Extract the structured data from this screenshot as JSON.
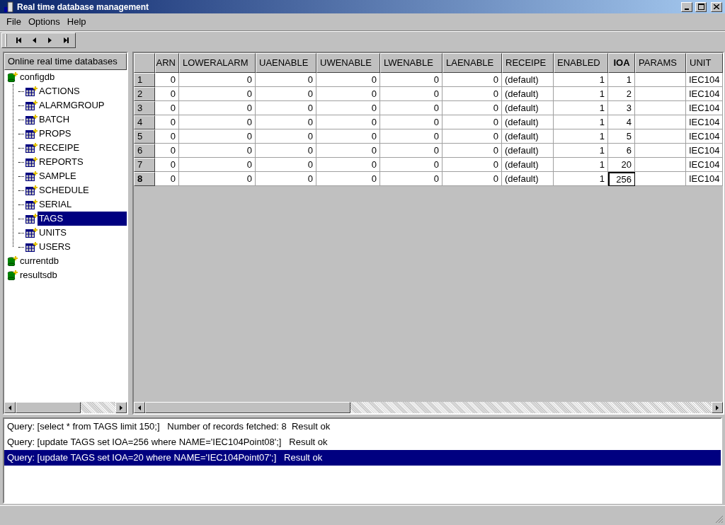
{
  "window": {
    "title": "Real time database management"
  },
  "menu": [
    "File",
    "Options",
    "Help"
  ],
  "tree": {
    "header": "Online real time databases",
    "items": [
      {
        "label": "configdb",
        "kind": "database",
        "selected": false,
        "children": [
          {
            "label": "ACTIONS",
            "kind": "table",
            "selected": false
          },
          {
            "label": "ALARMGROUP",
            "kind": "table",
            "selected": false
          },
          {
            "label": "BATCH",
            "kind": "table",
            "selected": false
          },
          {
            "label": "PROPS",
            "kind": "table",
            "selected": false
          },
          {
            "label": "RECEIPE",
            "kind": "table",
            "selected": false
          },
          {
            "label": "REPORTS",
            "kind": "table",
            "selected": false
          },
          {
            "label": "SAMPLE",
            "kind": "table",
            "selected": false
          },
          {
            "label": "SCHEDULE",
            "kind": "table",
            "selected": false
          },
          {
            "label": "SERIAL",
            "kind": "table",
            "selected": false
          },
          {
            "label": "TAGS",
            "kind": "table",
            "selected": true
          },
          {
            "label": "UNITS",
            "kind": "table",
            "selected": false
          },
          {
            "label": "USERS",
            "kind": "table",
            "selected": false
          }
        ]
      },
      {
        "label": "currentdb",
        "kind": "database",
        "selected": false
      },
      {
        "label": "resultsdb",
        "kind": "database",
        "selected": false
      }
    ]
  },
  "table": {
    "columns": [
      {
        "heading": "ARN",
        "kind": "number",
        "selected": false
      },
      {
        "heading": "LOWERALARM",
        "kind": "number",
        "selected": false
      },
      {
        "heading": "UAENABLE",
        "kind": "number",
        "selected": false
      },
      {
        "heading": "UWENABLE",
        "kind": "number",
        "selected": false
      },
      {
        "heading": "LWENABLE",
        "kind": "number",
        "selected": false
      },
      {
        "heading": "LAENABLE",
        "kind": "number",
        "selected": false
      },
      {
        "heading": "RECEIPE",
        "kind": "text",
        "selected": false
      },
      {
        "heading": "ENABLED",
        "kind": "number",
        "selected": false
      },
      {
        "heading": "IOA",
        "kind": "number",
        "selected": true
      },
      {
        "heading": "PARAMS",
        "kind": "text",
        "selected": false
      },
      {
        "heading": "UNIT",
        "kind": "text",
        "selected": false
      }
    ],
    "rows": [
      {
        "number": "1",
        "selected": false,
        "cells": [
          "0",
          "0",
          "0",
          "0",
          "0",
          "0",
          "(default)",
          "1",
          "1",
          "",
          "IEC104"
        ]
      },
      {
        "number": "2",
        "selected": false,
        "cells": [
          "0",
          "0",
          "0",
          "0",
          "0",
          "0",
          "(default)",
          "1",
          "2",
          "",
          "IEC104"
        ]
      },
      {
        "number": "3",
        "selected": false,
        "cells": [
          "0",
          "0",
          "0",
          "0",
          "0",
          "0",
          "(default)",
          "1",
          "3",
          "",
          "IEC104"
        ]
      },
      {
        "number": "4",
        "selected": false,
        "cells": [
          "0",
          "0",
          "0",
          "0",
          "0",
          "0",
          "(default)",
          "1",
          "4",
          "",
          "IEC104"
        ]
      },
      {
        "number": "5",
        "selected": false,
        "cells": [
          "0",
          "0",
          "0",
          "0",
          "0",
          "0",
          "(default)",
          "1",
          "5",
          "",
          "IEC104"
        ]
      },
      {
        "number": "6",
        "selected": false,
        "cells": [
          "0",
          "0",
          "0",
          "0",
          "0",
          "0",
          "(default)",
          "1",
          "6",
          "",
          "IEC104"
        ]
      },
      {
        "number": "7",
        "selected": false,
        "cells": [
          "0",
          "0",
          "0",
          "0",
          "0",
          "0",
          "(default)",
          "1",
          "20",
          "",
          "IEC104"
        ]
      },
      {
        "number": "8",
        "selected": true,
        "cells": [
          "0",
          "0",
          "0",
          "0",
          "0",
          "0",
          "(default)",
          "1",
          "256",
          "",
          "IEC104"
        ]
      }
    ]
  },
  "log": [
    {
      "text": "Query: [select * from TAGS limit 150;]   Number of records fetched: 8  Result ok",
      "selected": false
    },
    {
      "text": "Query: [update TAGS set IOA=256 where NAME='IEC104Point08';]   Result ok",
      "selected": false
    },
    {
      "text": "Query: [update TAGS set IOA=20 where NAME='IEC104Point07';]   Result ok",
      "selected": true
    }
  ]
}
